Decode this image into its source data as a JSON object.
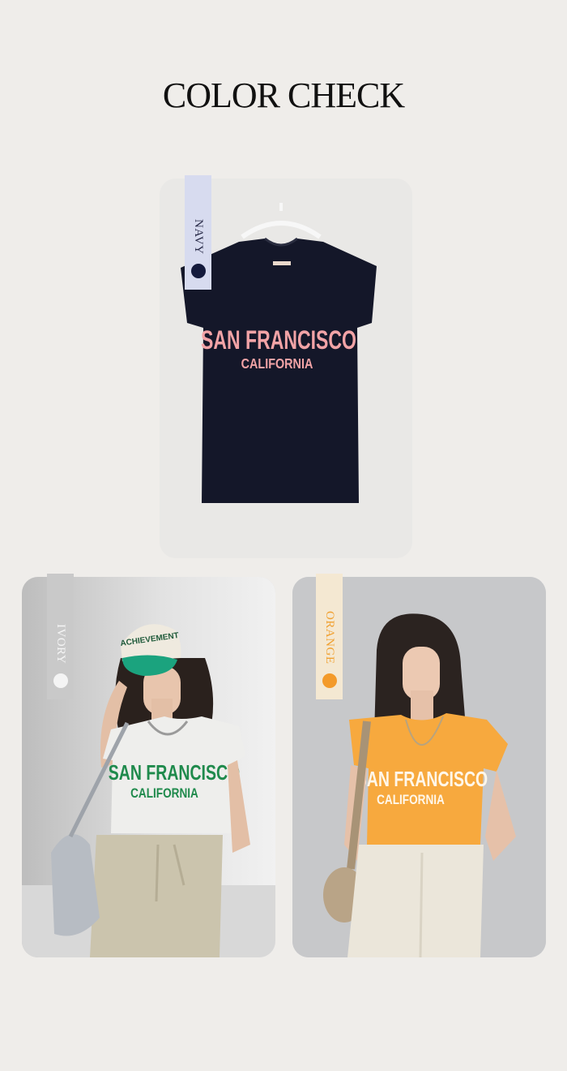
{
  "page": {
    "title": "COLOR CHECK"
  },
  "colors": [
    {
      "name": "NAVY",
      "swatch": "#141a3c",
      "shirt": "#141729",
      "print": "#f2a3a6"
    },
    {
      "name": "IVORY",
      "swatch": "#f4f4f4",
      "shirt": "#eeeeec",
      "print": "#1f8a4c"
    },
    {
      "name": "ORANGE",
      "swatch": "#f39a2a",
      "shirt": "#f7a93e",
      "print": "#fff7ea"
    }
  ],
  "shirt_print": {
    "line1": "SAN FRANCISCO",
    "line2": "CALIFORNIA"
  },
  "cap_print": {
    "line1": "ACHIEVEMENT"
  }
}
